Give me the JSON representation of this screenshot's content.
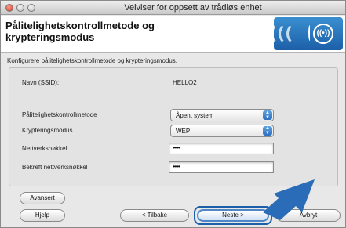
{
  "window": {
    "title": "Veiviser for oppsett av trådløs enhet"
  },
  "header": {
    "title": "Pålitelighetskontrollmetode og krypteringsmodus"
  },
  "description": "Konfigurere pålitelighetskontrollmetode og krypteringsmodus.",
  "form": {
    "ssid_label": "Navn (SSID):",
    "ssid_value": "HELLO2",
    "auth_label": "Pålitelighetskontrollmetode",
    "auth_value": "Åpent system",
    "encryption_label": "Krypteringsmodus",
    "encryption_value": "WEP",
    "key_label": "Nettverksnøkkel",
    "key_value": "•••••",
    "confirm_label": "Bekreft nettverksnøkkel",
    "confirm_value": "•••••"
  },
  "buttons": {
    "advanced": "Avansert",
    "help": "Hjelp",
    "back": "< Tilbake",
    "next": "Neste >",
    "cancel": "Avbryt"
  },
  "colors": {
    "accent": "#1d5fa8",
    "default_button": "#4f86c7"
  },
  "icons": {
    "wireless": "wireless-signal-icon",
    "pointer": "pointer-arrow-icon"
  }
}
